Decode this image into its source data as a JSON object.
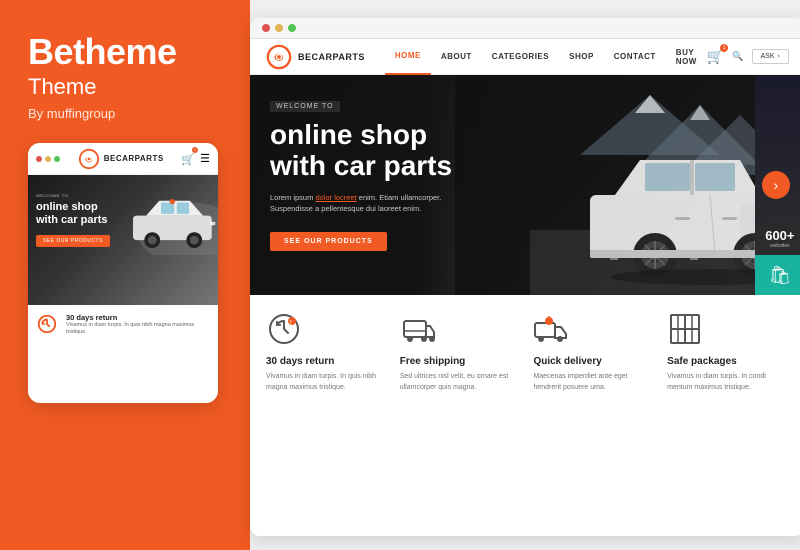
{
  "brand": {
    "title": "Betheme",
    "subtitle": "Theme",
    "by": "By muffingroup"
  },
  "mobile_mockup": {
    "dots": [
      "red",
      "yellow",
      "green"
    ],
    "logo_text": "BECARPARTS",
    "welcome": "WELCOME TO",
    "headline": "online shop\nwith car parts",
    "btn": "SEE OUR PRODUCTS",
    "feature": {
      "title": "30 days return",
      "desc": "Vivamus in diam turpis. In quis nibh magna maximus tristique."
    }
  },
  "desktop": {
    "dots": [
      "red",
      "yellow",
      "green"
    ],
    "logo_text": "BECARPARTS",
    "nav_items": [
      "HOME",
      "ABOUT",
      "CATEGORIES",
      "SHOP",
      "CONTACT",
      "BUY NOW"
    ],
    "active_nav": "HOME",
    "buy_btn": "BUY NOW",
    "ask_btn": "ASK",
    "welcome_to": "WELCOME TO",
    "headline_line1": "online shop",
    "headline_line2": "with car parts",
    "hero_desc": "Lorem ipsum dolor locreet enim. Etiam ullamcorper.\nSuspendisse a pellentesque dui laoreet enim.",
    "hero_link": "dolor locreet",
    "hero_btn": "SEE OUR PRODUCTS",
    "counter": "600+",
    "counter_label": "websites",
    "features": [
      {
        "icon": "return",
        "title": "30 days return",
        "desc": "Vivamus in diam turpis. In quis nibh magna maximus tristique."
      },
      {
        "icon": "shipping",
        "title": "Free shipping",
        "desc": "Sed ultrices nisl velit, eu ornare est ullamcorper quis magna."
      },
      {
        "icon": "delivery",
        "title": "Quick delivery",
        "desc": "Maecenas imperdiet ante eget hendrerit posuere uma."
      },
      {
        "icon": "package",
        "title": "Safe packages",
        "desc": "Vivamus in diam turpis. In condi mentum maximus tristique."
      }
    ]
  }
}
